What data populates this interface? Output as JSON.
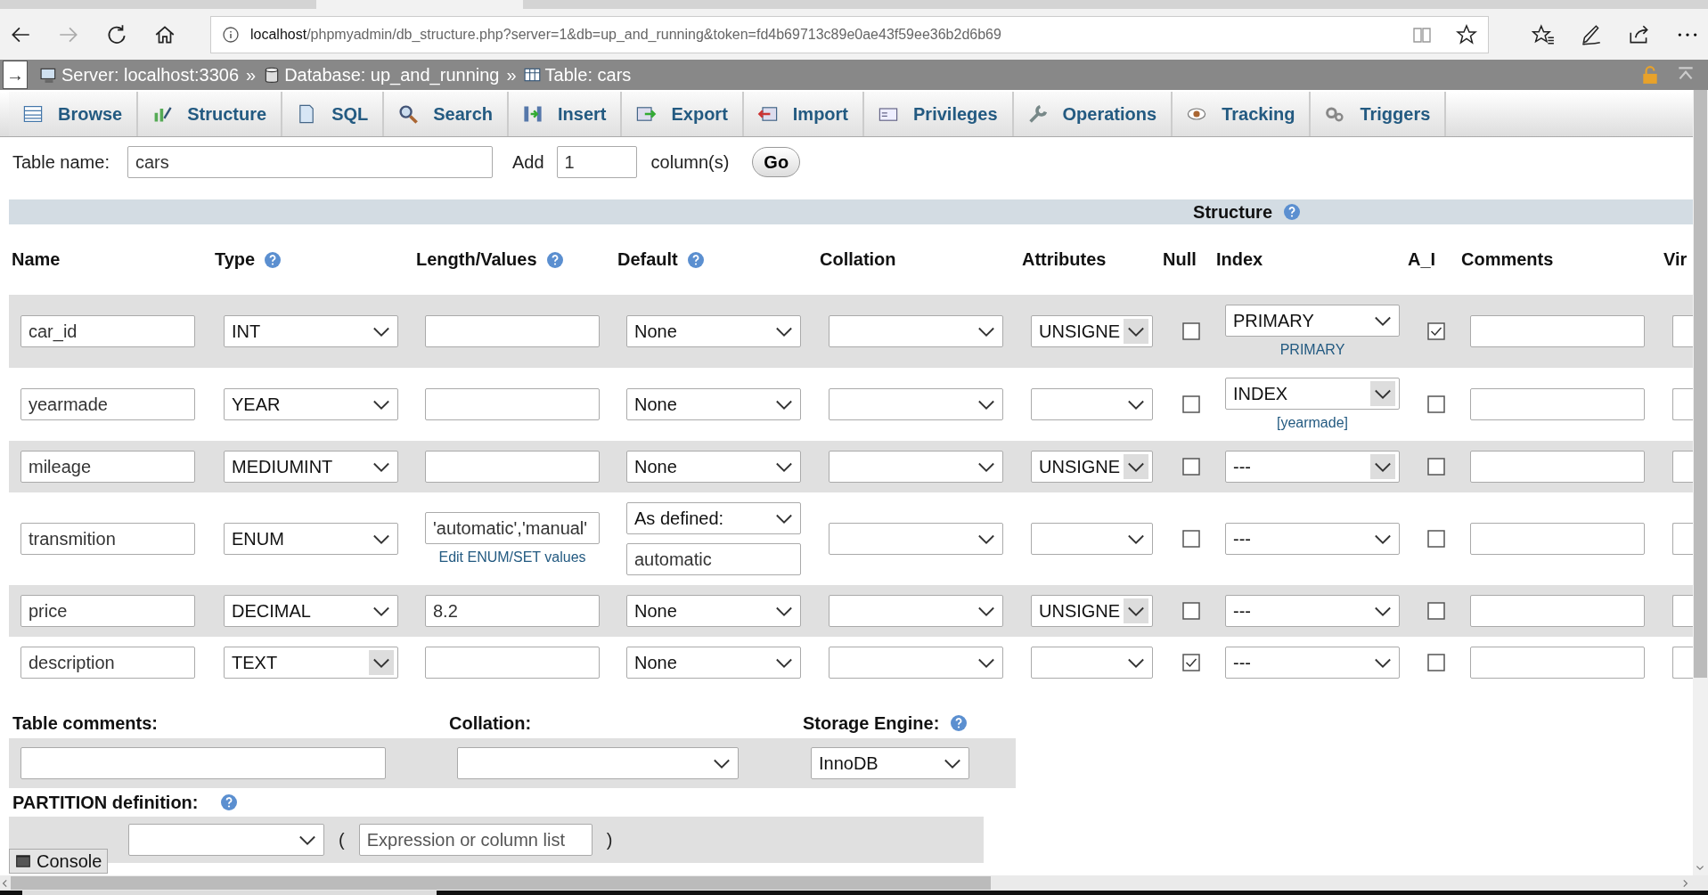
{
  "browser": {
    "url_host": "localhost",
    "url_path": "/phpmyadmin/db_structure.php?server=1&db=up_and_running&token=fd4b69713c89e0ae43f59ee36b2d6b69"
  },
  "breadcrumb": {
    "toggle": "→",
    "items": [
      {
        "kind": "server",
        "label": "Server: localhost:3306"
      },
      {
        "kind": "database",
        "label": "Database: up_and_running"
      },
      {
        "kind": "table",
        "label": "Table: cars"
      }
    ],
    "separator": "»"
  },
  "tabs": [
    {
      "label": "Browse",
      "selected": false
    },
    {
      "label": "Structure",
      "selected": false
    },
    {
      "label": "SQL",
      "selected": false
    },
    {
      "label": "Search",
      "selected": false
    },
    {
      "label": "Insert",
      "selected": false
    },
    {
      "label": "Export",
      "selected": false
    },
    {
      "label": "Import",
      "selected": false
    },
    {
      "label": "Privileges",
      "selected": false
    },
    {
      "label": "Operations",
      "selected": false
    },
    {
      "label": "Tracking",
      "selected": false
    },
    {
      "label": "Triggers",
      "selected": false
    }
  ],
  "form": {
    "table_name_label": "Table name:",
    "table_name": "cars",
    "add_label": "Add",
    "add_count": "1",
    "columns_label": "column(s)",
    "go": "Go"
  },
  "section_title": "Structure",
  "columns": [
    {
      "label": "Name",
      "help": false
    },
    {
      "label": "Type",
      "help": true
    },
    {
      "label": "Length/Values",
      "help": true
    },
    {
      "label": "Default",
      "help": true
    },
    {
      "label": "Collation",
      "help": false
    },
    {
      "label": "Attributes",
      "help": false
    },
    {
      "label": "Null",
      "help": false
    },
    {
      "label": "Index",
      "help": false
    },
    {
      "label": "A_I",
      "help": false
    },
    {
      "label": "Comments",
      "help": false
    },
    {
      "label": "Vir",
      "help": false
    }
  ],
  "rows": [
    {
      "name": "car_id",
      "type": {
        "value": "INT",
        "shaded": false
      },
      "default": {
        "value": "None"
      },
      "attribute": {
        "value": "UNSIGNE",
        "shaded": true
      },
      "null": false,
      "index": {
        "value": "PRIMARY",
        "shaded": false,
        "note": "PRIMARY"
      },
      "auto_increment": true
    },
    {
      "name": "yearmade",
      "type": {
        "value": "YEAR",
        "shaded": false
      },
      "default": {
        "value": "None"
      },
      "attribute": {
        "shaded": false
      },
      "null": false,
      "index": {
        "value": "INDEX",
        "shaded": true,
        "note": "[yearmade]"
      },
      "auto_increment": false
    },
    {
      "name": "mileage",
      "type": {
        "value": "MEDIUMINT",
        "shaded": false
      },
      "default": {
        "value": "None"
      },
      "attribute": {
        "value": "UNSIGNE",
        "shaded": true
      },
      "null": false,
      "index": {
        "value": "---",
        "shaded": true
      },
      "auto_increment": false
    },
    {
      "name": "transmition",
      "type": {
        "value": "ENUM",
        "shaded": false
      },
      "length": "'automatic','manual'",
      "length_link": "Edit ENUM/SET values",
      "default": {
        "value": "As defined:",
        "input": "automatic"
      },
      "attribute": {
        "shaded": false
      },
      "null": false,
      "index": {
        "value": "---",
        "shaded": false
      },
      "auto_increment": false
    },
    {
      "name": "price",
      "type": {
        "value": "DECIMAL",
        "shaded": false
      },
      "length": "8.2",
      "default": {
        "value": "None"
      },
      "attribute": {
        "value": "UNSIGNE",
        "shaded": true
      },
      "null": false,
      "index": {
        "value": "---",
        "shaded": false
      },
      "auto_increment": false
    },
    {
      "name": "description",
      "type": {
        "value": "TEXT",
        "shaded": true
      },
      "default": {
        "value": "None"
      },
      "attribute": {
        "shaded": false
      },
      "null": true,
      "index": {
        "value": "---",
        "shaded": false
      },
      "auto_increment": false
    }
  ],
  "table_options": {
    "comments_label": "Table comments:",
    "collation_label": "Collation:",
    "engine_label": "Storage Engine:",
    "engine": "InnoDB"
  },
  "partition": {
    "label": "PARTITION definition:",
    "open_paren": "(",
    "placeholder": "Expression or column list",
    "close_paren": ")"
  },
  "console": "Console"
}
